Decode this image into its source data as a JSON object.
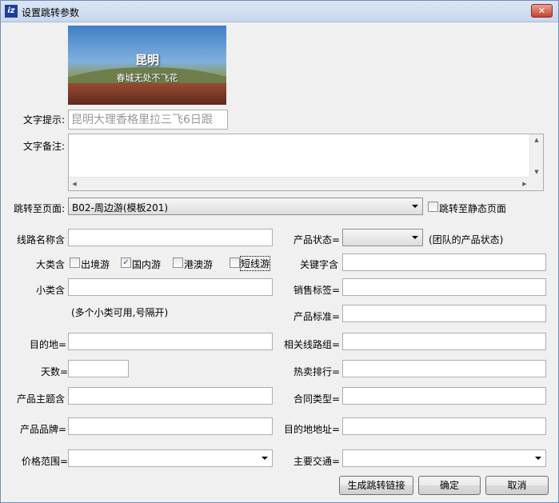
{
  "window": {
    "title": "设置跳转参数"
  },
  "banner": {
    "title": "昆明",
    "subtitle": "春城无处不飞花"
  },
  "text_hint": {
    "label": "文字提示:",
    "value": "昆明大理香格里拉三飞6日跟"
  },
  "text_note": {
    "label": "文字备注:",
    "value": ""
  },
  "jump_page": {
    "label": "跳转至页面:",
    "selected": "B02-周边游(模板201)",
    "static_checkbox_label": "跳转至静态页面"
  },
  "fields": {
    "route_name": {
      "label": "线路名称含",
      "value": ""
    },
    "big_category": {
      "label": "大类含",
      "options": [
        {
          "label": "出境游",
          "checked": false
        },
        {
          "label": "国内游",
          "checked": true
        },
        {
          "label": "港澳游",
          "checked": false
        },
        {
          "label": "短线游",
          "checked": false
        }
      ]
    },
    "small_category": {
      "label": "小类含",
      "value": "",
      "hint": "(多个小类可用,号隔开)"
    },
    "destination": {
      "label": "目的地=",
      "value": ""
    },
    "days": {
      "label": "天数=",
      "value": ""
    },
    "product_theme": {
      "label": "产品主题含",
      "value": ""
    },
    "product_brand": {
      "label": "产品品牌=",
      "value": ""
    },
    "price_range": {
      "label": "价格范围=",
      "selected": ""
    },
    "product_status": {
      "label": "产品状态=",
      "selected": "",
      "hint": "(团队的产品状态)"
    },
    "keyword": {
      "label": "关键字含",
      "value": ""
    },
    "sales_tag": {
      "label": "销售标签=",
      "value": ""
    },
    "product_standard": {
      "label": "产品标准=",
      "value": ""
    },
    "related_group": {
      "label": "相关线路组=",
      "value": ""
    },
    "hot_rank": {
      "label": "热卖排行=",
      "value": ""
    },
    "contract_type": {
      "label": "合同类型=",
      "value": ""
    },
    "dest_address": {
      "label": "目的地地址=",
      "value": ""
    },
    "main_transport": {
      "label": "主要交通=",
      "selected": ""
    }
  },
  "buttons": {
    "generate": "生成跳转链接",
    "ok": "确定",
    "cancel": "取消"
  }
}
